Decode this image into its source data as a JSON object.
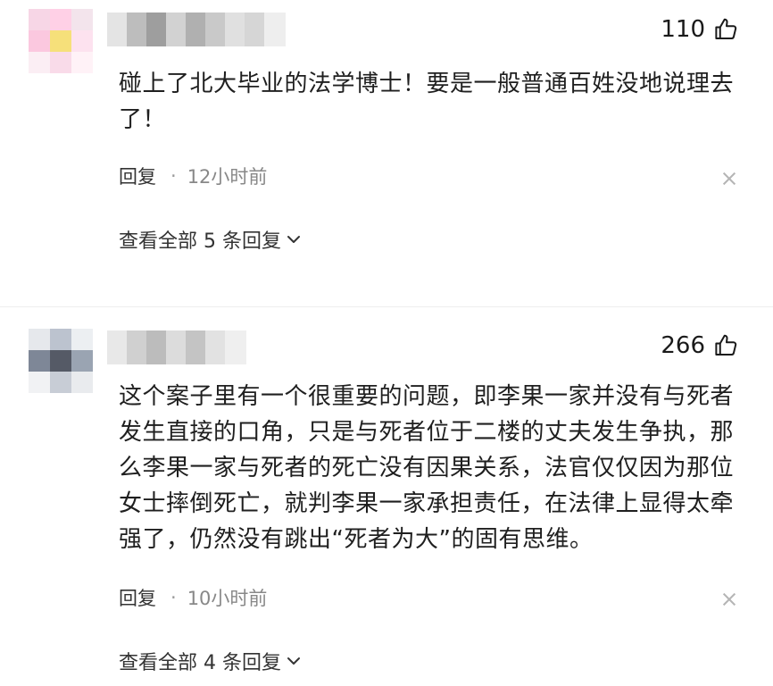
{
  "comments": [
    {
      "like_count": "110",
      "text": "碰上了北大毕业的法学博士！要是一般普通百姓没地说理去了！",
      "reply_label": "回复",
      "time": "12小时前",
      "view_all": "查看全部 5 条回复",
      "avatar_colors": [
        "#f7d6e6",
        "#ffd0e6",
        "#f3e4ec",
        "#fbc8df",
        "#f6e07a",
        "#fde2ef",
        "#fbeef4",
        "#f9dbe9",
        "#fff2f7"
      ]
    },
    {
      "like_count": "266",
      "text": "这个案子里有一个很重要的问题，即李果一家并没有与死者发生直接的口角，只是与死者位于二楼的丈夫发生争执，那么李果一家与死者的死亡没有因果关系，法官仅仅因为那位女士摔倒死亡，就判李果一家承担责任，在法律上显得太牵强了，仍然没有跳出“死者为大”的固有思维。",
      "reply_label": "回复",
      "time": "10小时前",
      "view_all": "查看全部 4 条回复",
      "avatar_colors": [
        "#e6e8ec",
        "#bcc3cf",
        "#eceff2",
        "#7e8797",
        "#555a66",
        "#9aa4b2",
        "#f1f2f4",
        "#c8cdd6",
        "#e9ebee"
      ]
    }
  ],
  "icons": {
    "like": "thumbs-up-icon",
    "close": "close-icon",
    "chevron": "chevron-down-icon"
  }
}
